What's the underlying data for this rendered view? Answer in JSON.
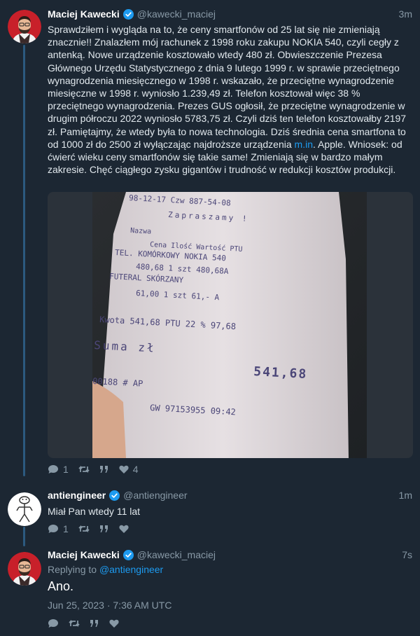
{
  "tweets": [
    {
      "name": "Maciej Kawecki",
      "handle": "@kawecki_maciej",
      "time": "3m",
      "text_before_link": "Sprawdziłem i wygląda na to, że ceny smartfonów od 25 lat się nie zmieniają znacznie!! Znalazłem mój rachunek z 1998 roku zakupu NOKIA 540, czyli cegły z antenką. Nowe urządzenie kosztowało wtedy 480 zł. Obwieszczenie Prezesa Głównego Urzędu Statystycznego z dnia 9 lutego 1999 r. w sprawie przeciętnego wynagrodzenia miesięcznego w 1998 r. wskazało, że przeciętne wynagrodzenie miesięczne w 1998 r. wyniosło 1.239,49 zł. Telefon kosztował więc 38 % przeciętnego wynagrodzenia. Prezes GUS ogłosił, że przeciętne wynagrodzenie w drugim półroczu 2022 wyniosło 5783,75 zł. Czyli dziś ten telefon kosztowałby 2197 zł. Pamiętajmy, że wtedy była to nowa technologia. Dziś średnia cena smartfona to od 1000 zł do 2500 zł wyłączając najdroższe urządzenia ",
      "link": "m.in",
      "text_after_link": ". Apple. Wniosek: od ćwierć wieku ceny smartfonów się takie same! Zmieniają się w bardzo małym zakresie. Chęć ciągłego zysku gigantów i trudność w redukcji kosztów produkcji.",
      "replies": "1",
      "likes": "4",
      "receipt": {
        "lines": [
          "98-12-17 Czw    887-54-08",
          "Zapraszamy !",
          "Nazwa",
          "Cena    Ilość    Wartość PTU",
          "TEL. KOMÓRKOWY NOKIA 540",
          "480,68      1    szt     480,68A",
          "FUTERAL SKÓRZANY",
          "61,00       1    szt      61,- A",
          "Kwota    541,68 PTU 22 %    97,68",
          "Suma zł",
          "541,68",
          "00188    # AP",
          "GW 97153955    09:42"
        ]
      }
    },
    {
      "name": "antiengineer",
      "handle": "@antiengineer",
      "time": "1m",
      "text": "Miał Pan wtedy 11 lat",
      "replies": "1"
    },
    {
      "name": "Maciej Kawecki",
      "handle": "@kawecki_maciej",
      "time": "7s",
      "replying_label": "Replying to",
      "replying_handle": "@antiengineer",
      "text": "Ano.",
      "date": "Jun 25, 2023 · 7:36 AM UTC"
    }
  ],
  "colors": {
    "background": "#1c2733",
    "accent": "#1d9bf0",
    "muted": "#8899a6",
    "thread_line": "#2c5a7f"
  },
  "icons": [
    "reply-icon",
    "retweet-icon",
    "quote-icon",
    "like-icon",
    "verified-icon"
  ]
}
